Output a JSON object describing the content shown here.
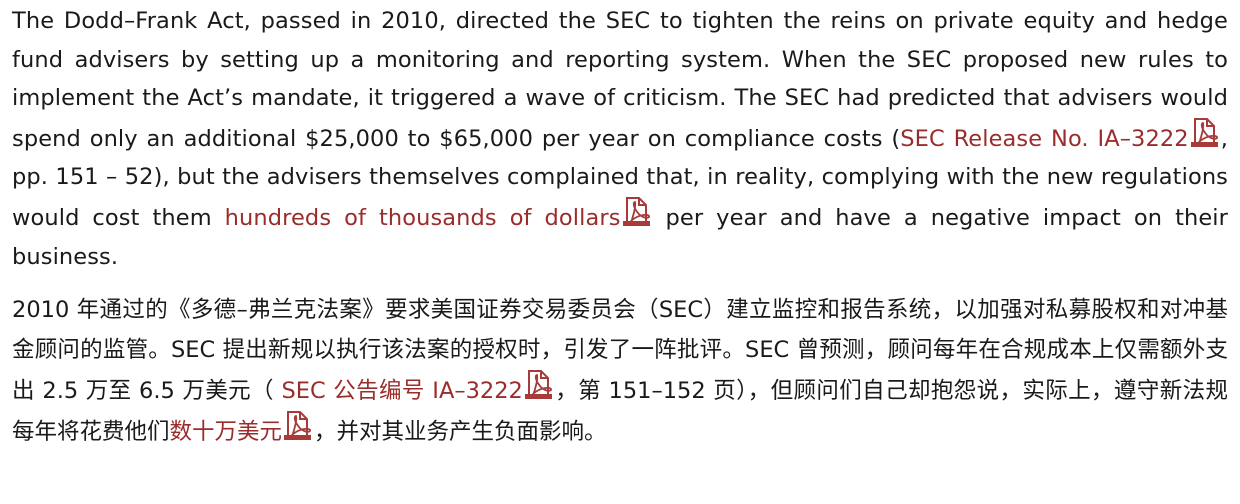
{
  "english": {
    "t1": "The Dodd–Frank Act, passed in 2010, directed the SEC to tighten the reins on private equity and hedge fund advisers by setting up a monitoring and reporting system. When the SEC proposed new rules to implement the Act’s mandate, it triggered a wave of criticism. The SEC had predicted that advisers would spend only an additional $25,000 to $65,000 per year on compliance costs (",
    "link1": "SEC Release No. IA–3222",
    "t2": ", pp. 151 – 52), but the advisers themselves complained that, in reality, complying with the new regulations would cost them ",
    "link2": "hundreds of thousands of dollars",
    "t3": " per year and have a negative impact on their business."
  },
  "chinese": {
    "t1": "2010 年通过的《多德–弗兰克法案》要求美国证券交易委员会（SEC）建立监控和报告系统，以加强对私募股权和对冲基金顾问的监管。SEC 提出新规以执行该法案的授权时，引发了一阵批评。SEC 曾预测，顾问每年在合规成本上仅需额外支出 2.5 万至 6.5 万美元（ ",
    "link1": "SEC 公告编号 IA–3222",
    "t2": "，第 151–152 页），但顾问们自己却抱怨说，实际上，遵守新法规每年将花费他们",
    "link2": "数十万美元",
    "t3": "，并对其业务产生负面影响。"
  },
  "icons": {
    "pdf": "pdf-icon"
  },
  "colors": {
    "text": "#1a1a1a",
    "link": "#9b2c2c",
    "icon": "#a83a3a"
  }
}
